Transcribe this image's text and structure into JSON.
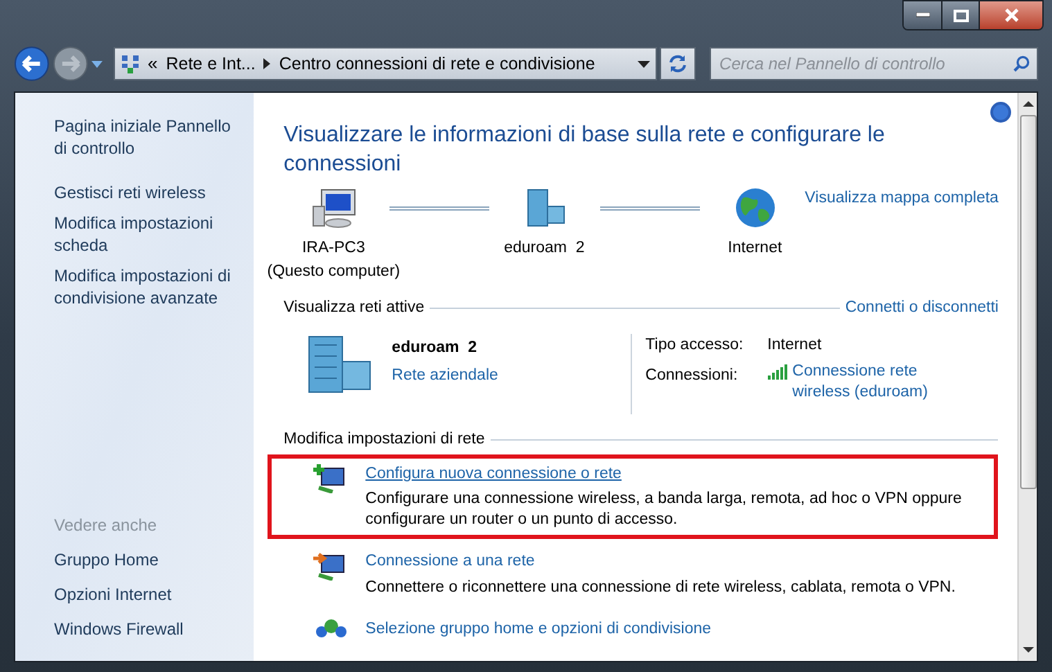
{
  "breadcrumb": {
    "overflow": "«",
    "segments": [
      "Rete e Int...",
      "Centro connessioni di rete e condivisione"
    ]
  },
  "search": {
    "placeholder": "Cerca nel Pannello di controllo"
  },
  "sidebar": {
    "items": [
      "Pagina iniziale Pannello di controllo",
      "Gestisci reti wireless",
      "Modifica impostazioni scheda",
      "Modifica impostazioni di condivisione avanzate"
    ],
    "see_also_title": "Vedere anche",
    "see_also": [
      "Gruppo Home",
      "Opzioni Internet",
      "Windows Firewall"
    ]
  },
  "heading": "Visualizzare le informazioni di base sulla rete e configurare le connessioni",
  "map": {
    "nodes": [
      {
        "kind": "computer",
        "label": "IRA-PC3",
        "sublabel": "(Questo computer)"
      },
      {
        "kind": "network",
        "label": "eduroam  2"
      },
      {
        "kind": "globe",
        "label": "Internet"
      }
    ],
    "link": "Visualizza mappa completa"
  },
  "active_networks": {
    "title": "Visualizza reti attive",
    "link": "Connetti o disconnetti",
    "name": "eduroam  2",
    "type": "Rete aziendale",
    "access_label": "Tipo accesso:",
    "access_value": "Internet",
    "connections_label": "Connessioni:",
    "connection": "Connessione rete wireless (eduroam)"
  },
  "settings": {
    "title": "Modifica impostazioni di rete",
    "tasks": [
      {
        "kind": "new",
        "link": "Configura nuova connessione o rete",
        "description": "Configurare una connessione wireless, a banda larga, remota, ad hoc o VPN oppure configurare un router o un punto di accesso.",
        "highlighted": true
      },
      {
        "kind": "connect",
        "link": "Connessione a una rete",
        "description": "Connettere o riconnettere una connessione di rete wireless, cablata, remota o VPN.",
        "highlighted": false
      },
      {
        "kind": "homegroup",
        "link": "Selezione gruppo home e opzioni di condivisione",
        "highlighted": false
      }
    ]
  }
}
